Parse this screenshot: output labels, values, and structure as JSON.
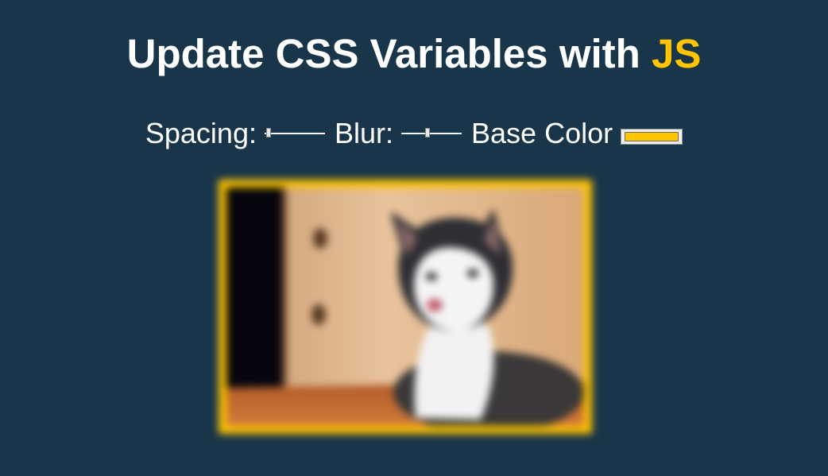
{
  "header": {
    "title_main": "Update CSS Variables with ",
    "title_highlight": "JS"
  },
  "controls": {
    "spacing_label": "Spacing:",
    "spacing_value": 0.02,
    "blur_label": "Blur:",
    "blur_value": 0.44,
    "base_color_label": "Base Color",
    "base_color": "#ffc600"
  },
  "image": {
    "subject": "cat-photo",
    "blurred": true
  },
  "colors": {
    "background": "#193549",
    "accent": "#ffc600",
    "text": "#ffffff"
  }
}
